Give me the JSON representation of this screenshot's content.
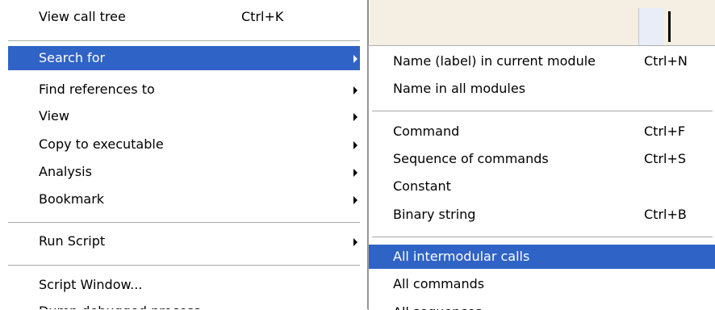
{
  "context_menu": {
    "items": [
      {
        "label": "View call tree",
        "shortcut": "Ctrl+K"
      },
      {
        "label": "Search for"
      },
      {
        "label": "Find references to"
      },
      {
        "label": "View"
      },
      {
        "label": "Copy to executable"
      },
      {
        "label": "Analysis"
      },
      {
        "label": "Bookmark"
      },
      {
        "label": "Run Script"
      },
      {
        "label": "Script Window..."
      },
      {
        "label": "Dump debugged process"
      }
    ]
  },
  "submenu": {
    "items": [
      {
        "label": "Name (label) in current module",
        "shortcut": "Ctrl+N"
      },
      {
        "label": "Name in all modules"
      },
      {
        "label": "Command",
        "shortcut": "Ctrl+F"
      },
      {
        "label": "Sequence of commands",
        "shortcut": "Ctrl+S"
      },
      {
        "label": "Constant"
      },
      {
        "label": "Binary string",
        "shortcut": "Ctrl+B"
      },
      {
        "label": "All intermodular calls"
      },
      {
        "label": "All commands"
      },
      {
        "label": "All sequences"
      }
    ]
  },
  "colors": {
    "highlight": "#2f63c6",
    "background_panel": "#f4efe2"
  }
}
